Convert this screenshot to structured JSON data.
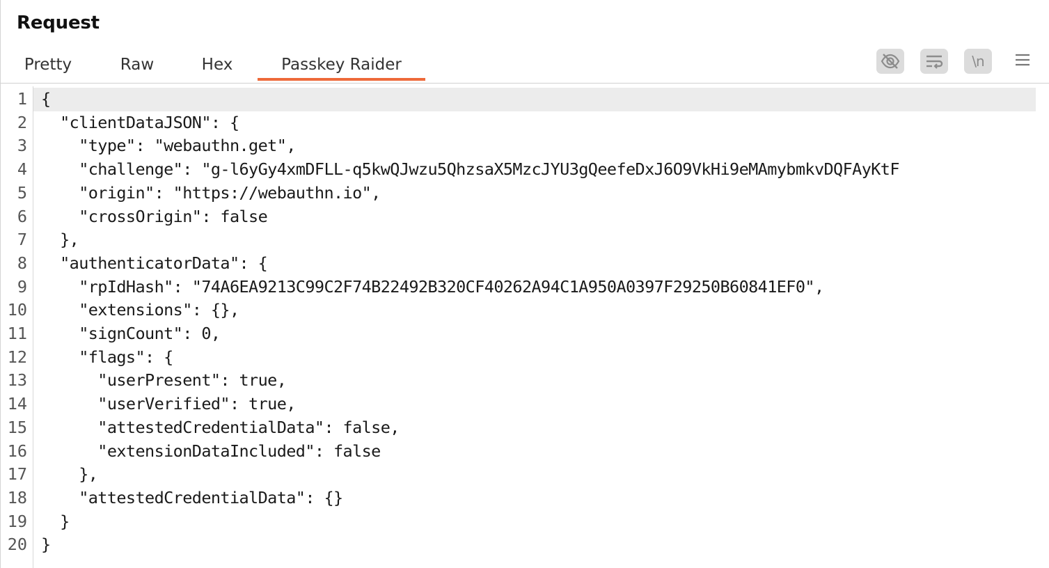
{
  "panel": {
    "title": "Request"
  },
  "tabs": [
    {
      "label": "Pretty",
      "active": false
    },
    {
      "label": "Raw",
      "active": false
    },
    {
      "label": "Hex",
      "active": false
    },
    {
      "label": "Passkey Raider",
      "active": true
    }
  ],
  "toolbar": {
    "icons": [
      "hide-nonprintable-icon",
      "word-wrap-icon",
      "newline-icon",
      "menu-icon"
    ],
    "newline_label": "\\n"
  },
  "colors": {
    "accent": "#ee6a3a",
    "current_line": "#ececec"
  },
  "editor": {
    "lines": [
      {
        "n": "1",
        "text": "{"
      },
      {
        "n": "2",
        "text": "  \"clientDataJSON\": {"
      },
      {
        "n": "3",
        "text": "    \"type\": \"webauthn.get\","
      },
      {
        "n": "4",
        "text": "    \"challenge\": \"g-l6yGy4xmDFLL-q5kwQJwzu5QhzsaX5MzcJYU3gQeefeDxJ6O9VkHi9eMAmybmkvDQFAyKtF"
      },
      {
        "n": "5",
        "text": "    \"origin\": \"https://webauthn.io\","
      },
      {
        "n": "6",
        "text": "    \"crossOrigin\": false"
      },
      {
        "n": "7",
        "text": "  },"
      },
      {
        "n": "8",
        "text": "  \"authenticatorData\": {"
      },
      {
        "n": "9",
        "text": "    \"rpIdHash\": \"74A6EA9213C99C2F74B22492B320CF40262A94C1A950A0397F29250B60841EF0\","
      },
      {
        "n": "10",
        "text": "    \"extensions\": {},"
      },
      {
        "n": "11",
        "text": "    \"signCount\": 0,"
      },
      {
        "n": "12",
        "text": "    \"flags\": {"
      },
      {
        "n": "13",
        "text": "      \"userPresent\": true,"
      },
      {
        "n": "14",
        "text": "      \"userVerified\": true,"
      },
      {
        "n": "15",
        "text": "      \"attestedCredentialData\": false,"
      },
      {
        "n": "16",
        "text": "      \"extensionDataIncluded\": false"
      },
      {
        "n": "17",
        "text": "    },"
      },
      {
        "n": "18",
        "text": "    \"attestedCredentialData\": {}"
      },
      {
        "n": "19",
        "text": "  }"
      },
      {
        "n": "20",
        "text": "}"
      }
    ]
  }
}
